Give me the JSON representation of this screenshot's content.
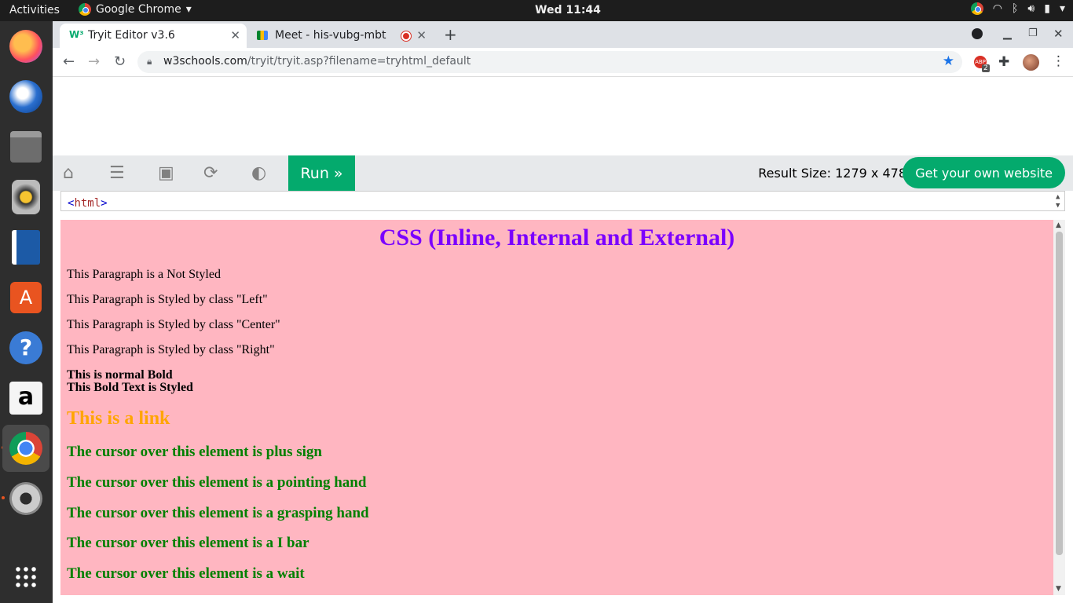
{
  "topbar": {
    "activities": "Activities",
    "app_name": "Google Chrome",
    "clock": "Wed 11:44"
  },
  "dock": {
    "items": [
      "firefox-icon",
      "thunderbird-icon",
      "files-icon",
      "rhythmbox-icon",
      "writer-icon",
      "software-icon",
      "help-icon",
      "amazon-icon",
      "chrome-icon",
      "settings-icon",
      "app-grid-icon"
    ]
  },
  "browser": {
    "tabs": [
      {
        "title": "Tryit Editor v3.6"
      },
      {
        "title": "Meet - his-vubg-mbt"
      }
    ],
    "url_host": "w3schools.com",
    "url_path": "/tryit/tryit.asp?filename=tryhtml_default",
    "extension_badge": "2"
  },
  "tryit": {
    "run_label": "Run »",
    "result_size": "Result Size: 1279 x 478",
    "get_website": "Get your own website",
    "code_tag": "html",
    "accent": "#04aa6d"
  },
  "result": {
    "heading": "CSS (Inline, Internal and External)",
    "p1": "This Paragraph is a Not Styled",
    "p2": "This Paragraph is Styled by class \"Left\"",
    "p3": "This Paragraph is Styled by class \"Center\"",
    "p4": "This Paragraph is Styled by class \"Right\"",
    "bold1": "This is normal Bold",
    "bold2": "This Bold Text is Styled",
    "link": "This is a link",
    "cursor1": "The cursor over this element is plus sign",
    "cursor2": "The cursor over this element is a pointing hand",
    "cursor3": "The cursor over this element is a grasping hand",
    "cursor4": "The cursor over this element is a I bar",
    "cursor5": "The cursor over this element is a wait",
    "background": "#ffb6c1"
  }
}
